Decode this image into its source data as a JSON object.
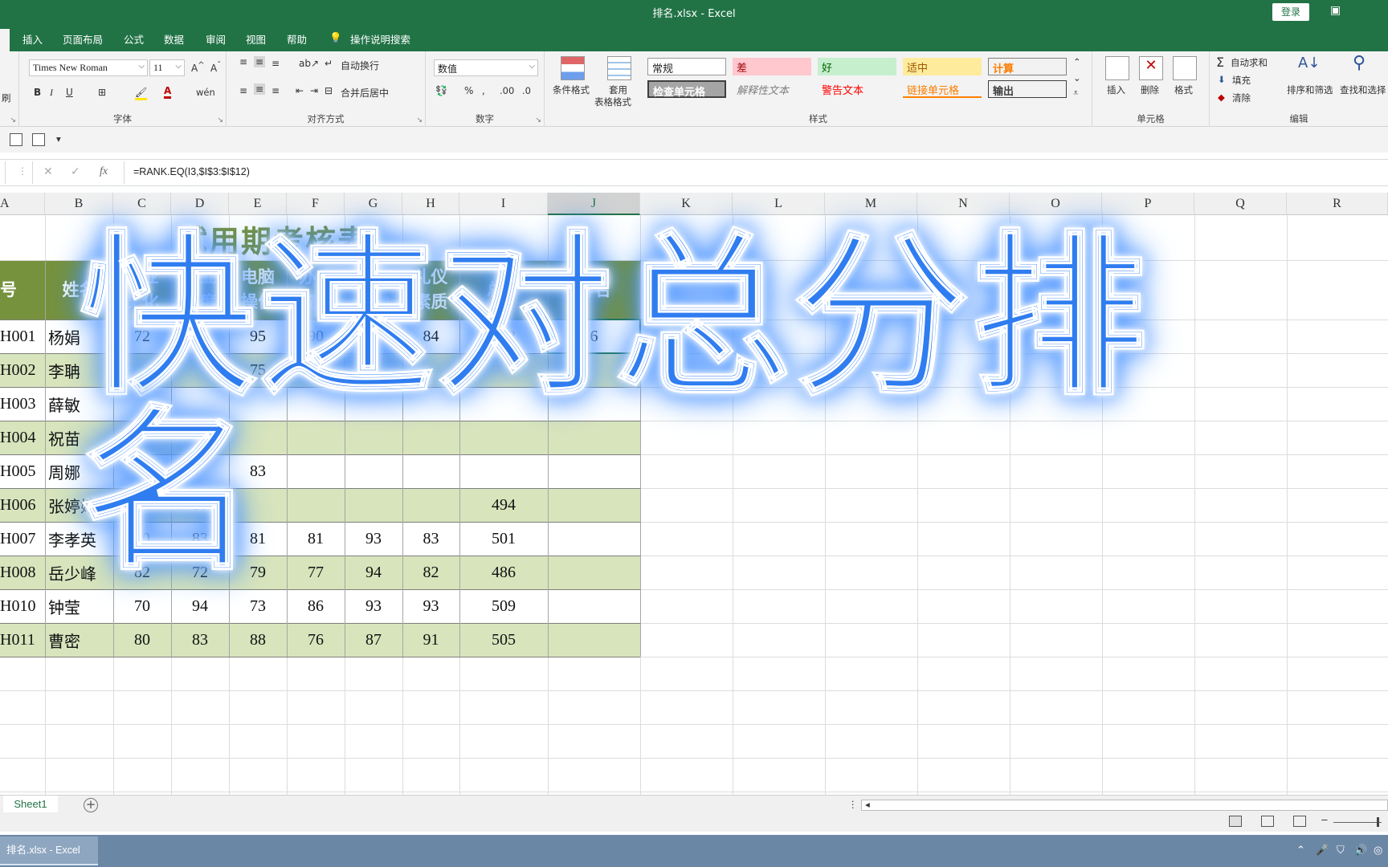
{
  "window": {
    "title": "排名.xlsx  -  Excel",
    "login_label": "登录"
  },
  "tabs": [
    "插入",
    "页面布局",
    "公式",
    "数据",
    "审阅",
    "视图",
    "帮助"
  ],
  "tell_me": "操作说明搜索",
  "ribbon": {
    "font": {
      "name": "Times New Roman",
      "size": "11",
      "label": "字体"
    },
    "alignment": {
      "wrap": "自动换行",
      "merge": "合并后居中",
      "label": "对齐方式"
    },
    "number": {
      "format": "数值",
      "label": "数字"
    },
    "styles": {
      "conditional": "条件格式",
      "table_a": "套用",
      "table_b": "表格格式",
      "label": "样式",
      "cells": [
        "常规",
        "差",
        "好",
        "适中",
        "计算",
        "检查单元格",
        "解释性文本",
        "警告文本",
        "链接单元格",
        "输出"
      ]
    },
    "cells": {
      "insert": "插入",
      "delete": "删除",
      "format": "格式",
      "label": "单元格"
    },
    "editing": {
      "autosum": "自动求和",
      "fill": "填充",
      "clear": "清除",
      "sort": "排序和筛选",
      "find": "查找和选择",
      "label": "编辑"
    },
    "clip_stub": "刷"
  },
  "formula_bar": {
    "fx": "fx",
    "formula": "=RANK.EQ(I3,$I$3:$I$12)"
  },
  "columns": [
    "A",
    "B",
    "C",
    "D",
    "E",
    "F",
    "G",
    "H",
    "I",
    "J",
    "K",
    "L",
    "M",
    "N",
    "O",
    "P",
    "Q",
    "R"
  ],
  "sheet": {
    "title": "试用期考核表",
    "headers": [
      {
        "line1": "号",
        "line2": ""
      },
      {
        "line1": "姓名",
        "line2": ""
      },
      {
        "line1": "企业",
        "line2": "文化"
      },
      {
        "line1": "企业",
        "line2": "制度"
      },
      {
        "line1": "电脑",
        "line2": "操作"
      },
      {
        "line1": "办公",
        "line2": "应用"
      },
      {
        "line1": "管理",
        "line2": "能力"
      },
      {
        "line1": "礼仪",
        "line2": "素质"
      },
      {
        "line1": "总分",
        "line2": ""
      },
      {
        "line1": "排名",
        "line2": ""
      }
    ],
    "rows": [
      [
        "H001",
        "杨娟",
        "72",
        "79",
        "95",
        "90",
        "72",
        "84",
        "492",
        "6"
      ],
      [
        "H002",
        "李聃",
        "",
        "",
        "75",
        "",
        "",
        "",
        "",
        ""
      ],
      [
        "H003",
        "薛敏",
        "",
        "",
        "",
        "",
        "",
        "",
        "",
        ""
      ],
      [
        "H004",
        "祝苗",
        "",
        "",
        "",
        "",
        "",
        "",
        "",
        ""
      ],
      [
        "H005",
        "周娜",
        "",
        "",
        "83",
        "",
        "",
        "",
        "",
        ""
      ],
      [
        "H006",
        "张婷婷",
        "",
        "80",
        "",
        "",
        "",
        "",
        "494",
        ""
      ],
      [
        "H007",
        "李孝英",
        "80",
        "83",
        "81",
        "81",
        "93",
        "83",
        "501",
        ""
      ],
      [
        "H008",
        "岳少峰",
        "82",
        "72",
        "79",
        "77",
        "94",
        "82",
        "486",
        ""
      ],
      [
        "H010",
        "钟莹",
        "70",
        "94",
        "73",
        "86",
        "93",
        "93",
        "509",
        ""
      ],
      [
        "H011",
        "曹密",
        "80",
        "83",
        "88",
        "76",
        "87",
        "91",
        "505",
        ""
      ]
    ]
  },
  "overlay_text": "快速对总分排名",
  "sheet_tab": "Sheet1",
  "taskbar": {
    "item": "排名.xlsx - Excel"
  },
  "colors": {
    "excel_green": "#217346",
    "header_fill": "#76923c",
    "band_fill": "#d8e4bc",
    "overlay_blue": "#2f7df0"
  }
}
